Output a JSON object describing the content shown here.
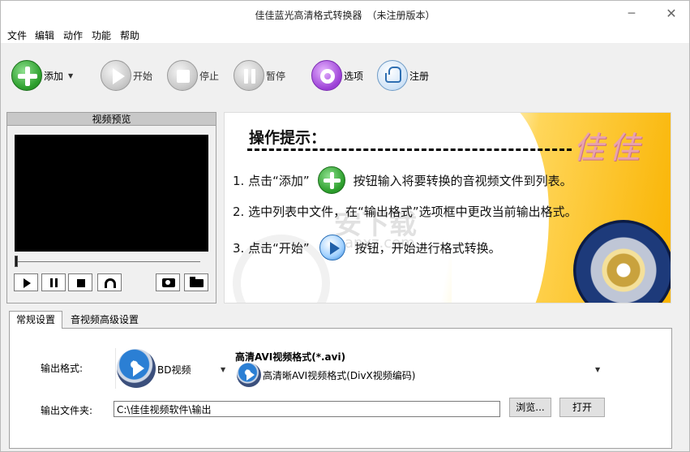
{
  "window": {
    "title": "佳佳蓝光高清格式转换器　（未注册版本）",
    "minimize_icon": "minimize-icon",
    "close_icon": "close-icon"
  },
  "menu": [
    "文件",
    "编辑",
    "动作",
    "功能",
    "帮助"
  ],
  "toolbar": {
    "add": "添加",
    "start": "开始",
    "stop": "停止",
    "pause": "暂停",
    "options": "选项",
    "register": "注册"
  },
  "preview": {
    "title": "视频预览"
  },
  "tips": {
    "title": "操作提示：",
    "logo": "佳佳",
    "line1_pre": "1. 点击“添加”",
    "line1_post": "按钮输入将要转换的音视频文件到列表。",
    "line2": "2. 选中列表中文件，在“输出格式”选项框中更改当前输出格式。",
    "line3_pre": "3. 点击“开始”",
    "line3_post": "按钮，开始进行格式转换。",
    "watermark": "安下载",
    "watermark_sub": "anxz.com"
  },
  "tabs": [
    "常规设置",
    "音视频高级设置"
  ],
  "settings": {
    "output_format_label": "输出格式:",
    "format_value": "BD视频",
    "subformat_title": "高清AVI视频格式(*.avi)",
    "subformat_value": "高清晰AVI视频格式(DivX视频编码)",
    "output_folder_label": "输出文件夹:",
    "output_folder_value": "C:\\佳佳视频软件\\输出",
    "browse": "浏览...",
    "open": "打开"
  }
}
